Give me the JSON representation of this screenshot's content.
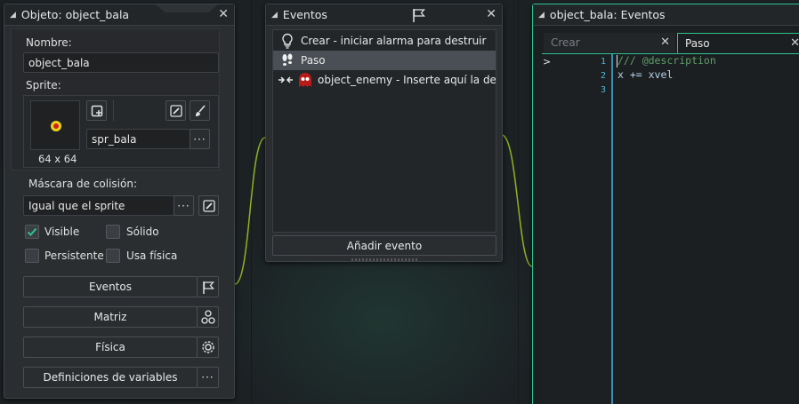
{
  "colors": {
    "accent_green": "#2ec38a",
    "wire": "#8fb423",
    "code_comment": "#5f9f6a",
    "line_numbers": "#4cb8d8"
  },
  "object_panel": {
    "title": "Objeto: object_bala",
    "name_label": "Nombre:",
    "name_value": "object_bala",
    "sprite_label": "Sprite:",
    "sprite_size": "64 x 64",
    "sprite_name": "spr_bala",
    "mask_label": "Máscara de colisión:",
    "mask_value": "Igual que el sprite",
    "checkboxes": {
      "visible": {
        "label": "Visible",
        "checked": true
      },
      "solid": {
        "label": "Sólido",
        "checked": false
      },
      "persistent": {
        "label": "Persistente",
        "checked": false
      },
      "physics": {
        "label": "Usa física",
        "checked": false
      }
    },
    "buttons": {
      "events": "Eventos",
      "parent": "Matriz",
      "physics": "Física",
      "variables": "Definiciones de variables"
    }
  },
  "events_panel": {
    "title": "Eventos",
    "events": [
      {
        "label": "Crear - iniciar alarma para destruir",
        "icon": "lightbulb-icon",
        "selected": false
      },
      {
        "label": "Paso",
        "icon": "footsteps-icon",
        "selected": true
      },
      {
        "label": "object_enemy - Inserte aquí la descripción",
        "icon": "collision-icon",
        "selected": false
      }
    ],
    "add_button": "Añadir evento"
  },
  "code_panel": {
    "title": "object_bala: Eventos",
    "tabs": [
      {
        "label": "Crear",
        "active": false
      },
      {
        "label": "Paso",
        "active": true
      }
    ],
    "line_numbers": [
      "1",
      "2",
      "3"
    ],
    "lines": [
      "/// @description",
      "x += xvel",
      ""
    ]
  }
}
